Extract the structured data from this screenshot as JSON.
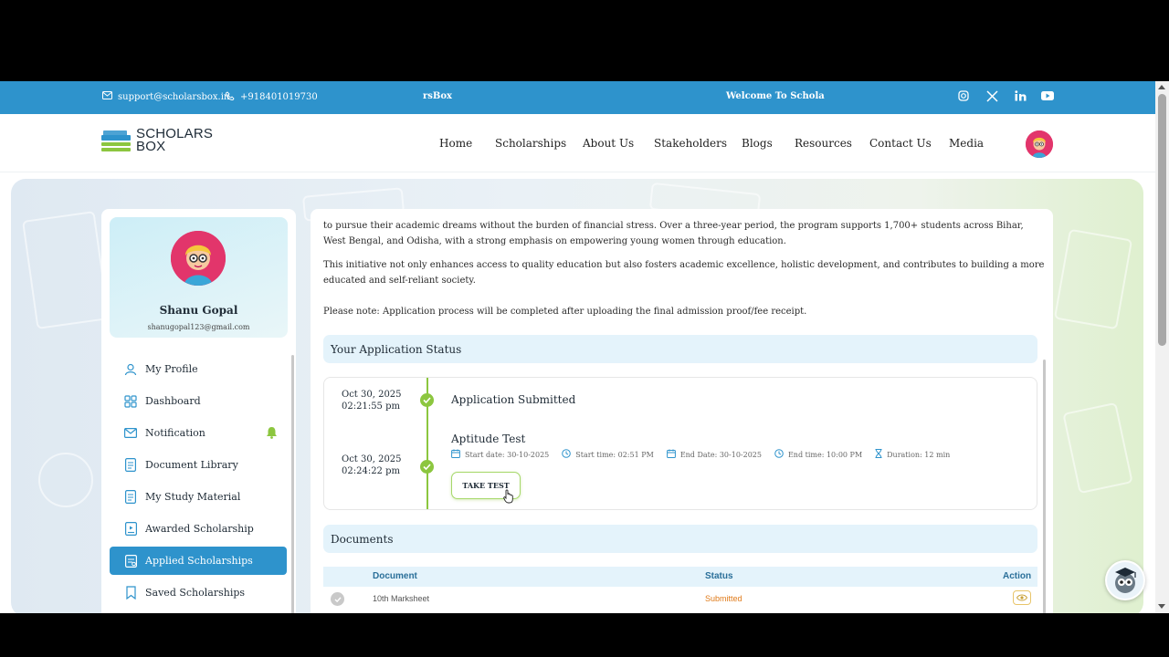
{
  "topbar": {
    "email": "support@scholarsbox.in",
    "phone": "+918401019730",
    "marquee_left": "rsBox",
    "marquee_right": "Welcome To Schola",
    "social": [
      "instagram-icon",
      "x-icon",
      "linkedin-icon",
      "youtube-icon"
    ]
  },
  "header": {
    "logo_line1": "SCHOLARS",
    "logo_line2": "BOX",
    "nav": [
      "Home",
      "Scholarships",
      "About Us",
      "Stakeholders",
      "Blogs",
      "Resources",
      "Contact Us",
      "Media"
    ]
  },
  "sidebar": {
    "name": "Shanu Gopal",
    "email": "shanugopal123@gmail.com",
    "items": [
      {
        "label": "My Profile",
        "icon": "user-icon"
      },
      {
        "label": "Dashboard",
        "icon": "grid-icon"
      },
      {
        "label": "Notification",
        "icon": "mail-icon"
      },
      {
        "label": "Document Library",
        "icon": "document-icon"
      },
      {
        "label": "My Study Material",
        "icon": "document-icon"
      },
      {
        "label": "Awarded Scholarship",
        "icon": "certificate-icon"
      },
      {
        "label": "Applied Scholarships",
        "icon": "clipboard-icon"
      },
      {
        "label": "Saved Scholarships",
        "icon": "bookmark-icon"
      }
    ],
    "active_index": 6
  },
  "main": {
    "para1": "to pursue their academic dreams without the burden of financial stress. Over a three-year period, the program supports 1,700+ students across Bihar, West Bengal, and Odisha, with a strong emphasis on empowering young women through education.",
    "para2": "This initiative not only enhances access to quality education but also fosters academic excellence, holistic development, and contributes to building a more educated and self-reliant society.",
    "note": "Please note: Application process will be completed after uploading the final admission proof/fee receipt.",
    "status_title": "Your Application Status",
    "timeline": [
      {
        "date": "Oct 30, 2025",
        "time": "02:21:55 pm",
        "title": "Application Submitted"
      },
      {
        "date": "Oct 30, 2025",
        "time": "02:24:22 pm",
        "title": "Aptitude Test"
      }
    ],
    "test_meta": {
      "start_date": "Start date: 30-10-2025",
      "start_time": "Start time: 02:51 PM",
      "end_date": "End Date: 30-10-2025",
      "end_time": "End time: 10:00 PM",
      "duration": "Duration: 12 min"
    },
    "take_test_label": "TAKE TEST",
    "documents_title": "Documents",
    "doc_columns": [
      "Document",
      "Status",
      "Action"
    ],
    "doc_rows": [
      {
        "document": "10th Marksheet",
        "status": "Submitted"
      }
    ],
    "colors": {
      "accent": "#2e93cc",
      "success": "#8cc63f",
      "submitted": "#e07b1a"
    }
  }
}
